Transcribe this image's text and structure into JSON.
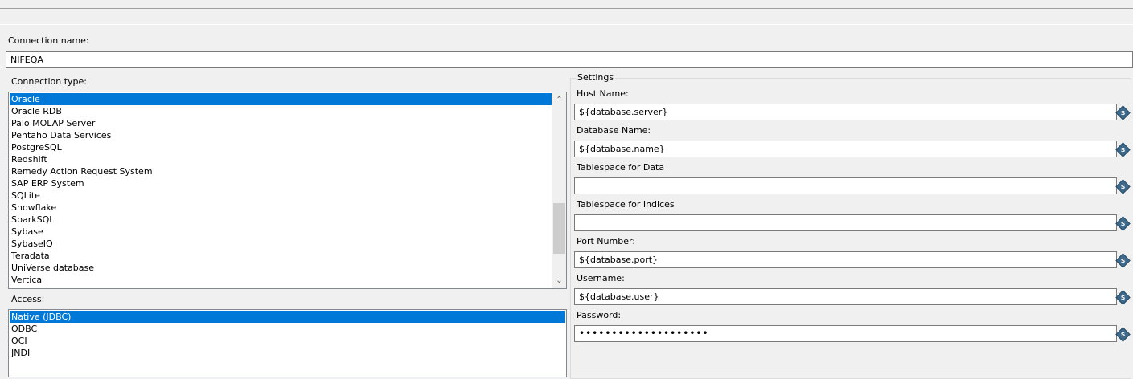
{
  "connection_name": {
    "label": "Connection name:",
    "value": "NIFEQA"
  },
  "connection_type": {
    "label": "Connection type:",
    "items": [
      "Oracle",
      "Oracle RDB",
      "Palo MOLAP Server",
      "Pentaho Data Services",
      "PostgreSQL",
      "Redshift",
      "Remedy Action Request System",
      "SAP ERP System",
      "SQLite",
      "Snowflake",
      "SparkSQL",
      "Sybase",
      "SybaseIQ",
      "Teradata",
      "UniVerse database",
      "Vertica"
    ],
    "selected": "Oracle",
    "scroll_position": 0.82
  },
  "access": {
    "label": "Access:",
    "items": [
      "Native (JDBC)",
      "ODBC",
      "OCI",
      "JNDI"
    ],
    "selected": "Native (JDBC)"
  },
  "settings": {
    "title": "Settings",
    "fields": [
      {
        "label": "Host Name:",
        "value": "${database.server}"
      },
      {
        "label": "Database Name:",
        "value": "${database.name}"
      },
      {
        "label": "Tablespace for Data",
        "value": ""
      },
      {
        "label": "Tablespace for Indices",
        "value": ""
      },
      {
        "label": "Port Number:",
        "value": "${database.port}"
      },
      {
        "label": "Username:",
        "value": "${database.user}"
      },
      {
        "label": "Password:",
        "value": "••••••••••••••••••••"
      }
    ]
  },
  "icons": {
    "variable": "variable-diamond-icon",
    "scroll_up": "chevron-up-icon",
    "scroll_down": "chevron-down-icon"
  },
  "colors": {
    "selection": "#0078d7",
    "variable_icon": "#3d6a8c"
  }
}
